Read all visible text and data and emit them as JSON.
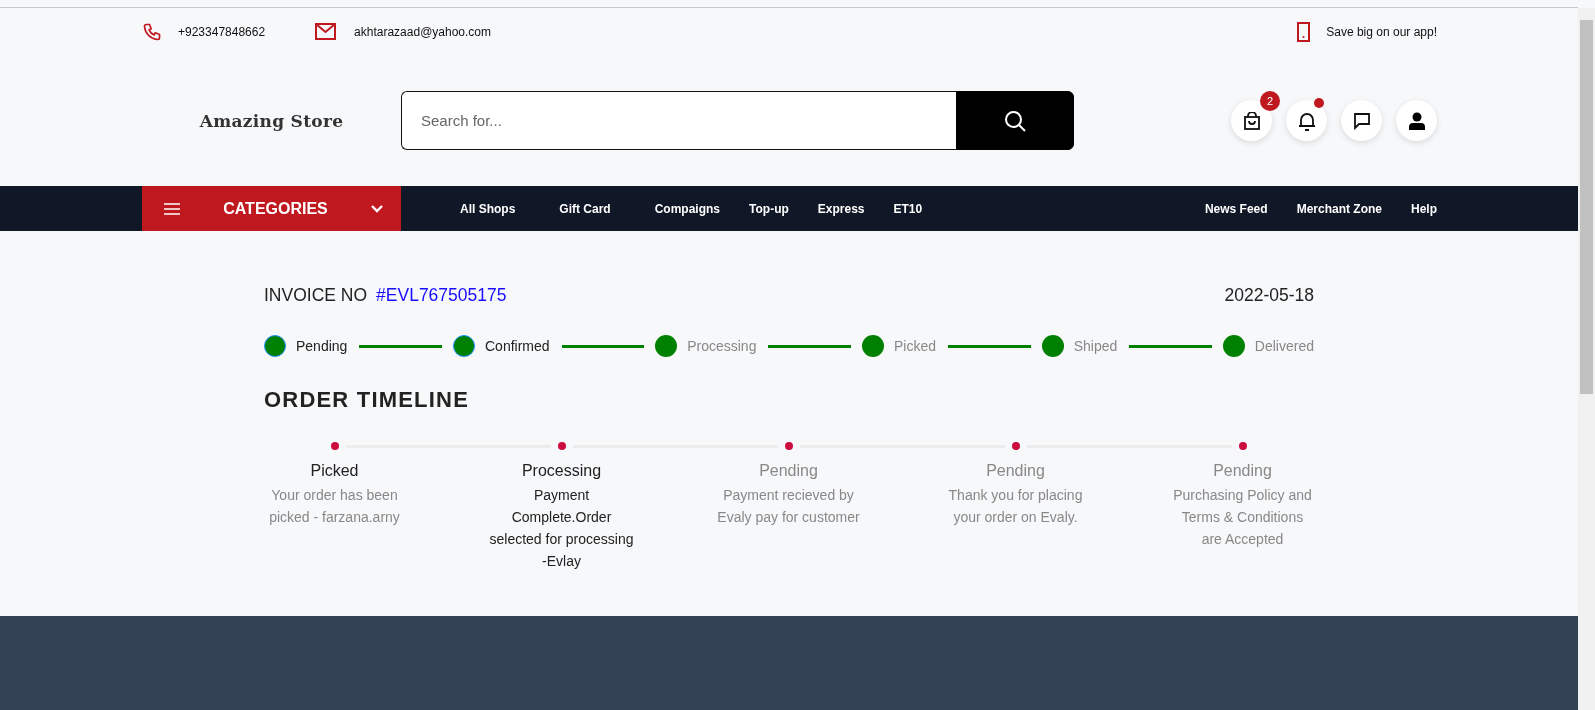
{
  "topbar": {
    "phone": "+923347848662",
    "email": "akhtarazaad@yahoo.com",
    "app_promo": "Save big on our app!"
  },
  "header": {
    "logo": "Amazing Store",
    "search": {
      "placeholder": "Search for..."
    },
    "cart_count": "2",
    "notifications_unread": true
  },
  "nav": {
    "categories_label": "CATEGORIES",
    "links": [
      "All Shops",
      "Gift Card",
      "Compaigns",
      "Top-up",
      "Express",
      "ET10"
    ],
    "right_links": [
      "News Feed",
      "Merchant Zone",
      "Help"
    ]
  },
  "invoice": {
    "label": "INVOICE NO",
    "number": "#EVL767505175",
    "date": "2022-05-18"
  },
  "progress_steps": [
    {
      "label": "Pending",
      "reached": true
    },
    {
      "label": "Confirmed",
      "reached": true
    },
    {
      "label": "Processing",
      "reached": false
    },
    {
      "label": "Picked",
      "reached": false
    },
    {
      "label": "Shiped",
      "reached": false
    },
    {
      "label": "Delivered",
      "reached": false
    }
  ],
  "timeline": {
    "title": "ORDER TIMELINE",
    "entries": [
      {
        "title": "Picked",
        "description": "Your order has been picked - farzana.arny",
        "kind": "past"
      },
      {
        "title": "Processing",
        "description": "Payment Complete.Order selected for processing -Evlay",
        "kind": "current"
      },
      {
        "title": "Pending",
        "description": "Payment recieved by Evaly pay for customer",
        "kind": "future"
      },
      {
        "title": "Pending",
        "description": "Thank you for placing your order on Evaly.",
        "kind": "future"
      },
      {
        "title": "Pending",
        "description": "Purchasing Policy and Terms & Conditions are Accepted",
        "kind": "future"
      }
    ]
  }
}
